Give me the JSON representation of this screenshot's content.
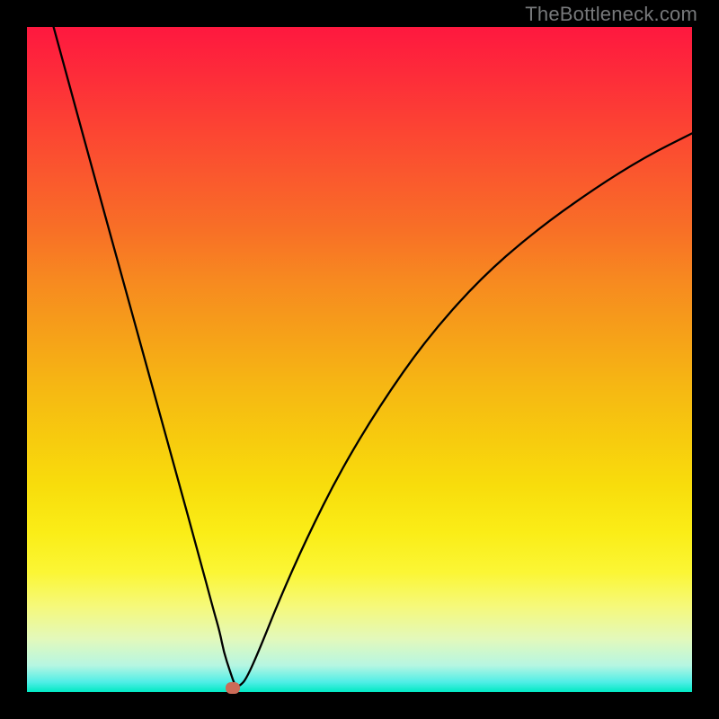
{
  "attribution": "TheBottleneck.com",
  "chart_data": {
    "type": "line",
    "title": "",
    "xlabel": "",
    "ylabel": "",
    "xlim": [
      0,
      100
    ],
    "ylim": [
      0,
      100
    ],
    "series": [
      {
        "name": "curve",
        "x": [
          4,
          7,
          10,
          14,
          18,
          22,
          26,
          28,
          29,
          29.6,
          30.5,
          31.3,
          32,
          33,
          35,
          38,
          42,
          47,
          53,
          60,
          68,
          76,
          85,
          93,
          100
        ],
        "values": [
          100,
          89,
          78,
          63.5,
          49,
          34.5,
          20,
          12.5,
          9,
          6,
          3.2,
          0.9,
          0.9,
          2,
          6.5,
          14,
          23,
          33,
          43,
          53,
          62,
          69,
          75.5,
          80.5,
          84
        ]
      }
    ],
    "marker": {
      "x": 31,
      "y": 0.7
    },
    "gradient_stops": [
      {
        "pos": 0,
        "color": "#fe183f"
      },
      {
        "pos": 50,
        "color": "#f6ac16"
      },
      {
        "pos": 80,
        "color": "#faf029"
      },
      {
        "pos": 100,
        "color": "#00e9c3"
      }
    ]
  }
}
